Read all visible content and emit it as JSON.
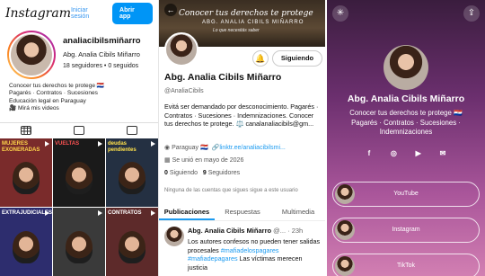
{
  "instagram": {
    "logo": "Instagram",
    "login": "Iniciar sesión",
    "open_app": "Abrir app",
    "username": "analiacibilsmiñarro",
    "name": "Abg. Analia Cibils Miñarro",
    "stats": "18 seguidores • 0 seguidos",
    "bio": [
      "Conocer tus derechos te protege 🇵🇾",
      "Pagarés · Contratos · Sucesiones",
      "Educación legal en Paraguay",
      "🎥 Mirá mis videos"
    ],
    "posts": [
      {
        "caption": "MUJERES EXONERADAS",
        "bg": "#7a2b2b",
        "color": "#ffd54a"
      },
      {
        "caption": "VUELTAS",
        "bg": "#1a1a1a",
        "color": "#ff5252"
      },
      {
        "caption": "deudas pendientes",
        "bg": "#243042",
        "color": "#ffe14a"
      },
      {
        "caption": "EXTRAJUDICIALES",
        "bg": "#2d2d6e",
        "color": "#ffffff"
      },
      {
        "caption": "",
        "bg": "#3a3a3a",
        "color": "#ffffff"
      },
      {
        "caption": "CONTRATOS",
        "bg": "#5d2a2a",
        "color": "#ffffff"
      }
    ]
  },
  "twitter": {
    "banner_title": "Conocer tus derechos te protege",
    "banner_name": "ABG. ANALIA CIBILS MIÑARRO",
    "banner_sub": "Lo que necesitás saber",
    "follow": "Siguiendo",
    "name": "Abg. Analia Cibils Miñarro",
    "handle": "@AnaliaCibils",
    "bio": "Evitá ser demandado por desconocimiento. Pagarés · Contratos · Sucesiones · Indemnizaciones. Conocer tus derechos te protege. ⚖️ canalanaliacibils@gm...",
    "location": "Paraguay 🇵🇾",
    "link": "linktr.ee/analiacibilsmi...",
    "joined": "Se unió en mayo de 2026",
    "following_count": "0",
    "following_label": "Siguiendo",
    "followers_count": "9",
    "followers_label": "Seguidores",
    "none_follow": "Ninguna de las cuentas que sigues sigue a este usuario",
    "tabs": [
      "Publicaciones",
      "Respuestas",
      "Multimedia"
    ],
    "post": {
      "author": "Abg. Analia Cibils Miñarro",
      "meta": "@... · 23h",
      "text": "Los autores confesos no pueden tener salidas procesales",
      "tags": "#mafiadelospagares #mafiadepagares",
      "text2": "Las víctimas merecen justicia"
    }
  },
  "linktree": {
    "name": "Abg. Analia Cibils Miñarro",
    "bio": "Conocer tus derechos te protege 🇵🇾 Pagarés · Contratos · Sucesiones · Indemnizaciones",
    "links": [
      "YouTube",
      "Instagram",
      "TikTok"
    ]
  }
}
